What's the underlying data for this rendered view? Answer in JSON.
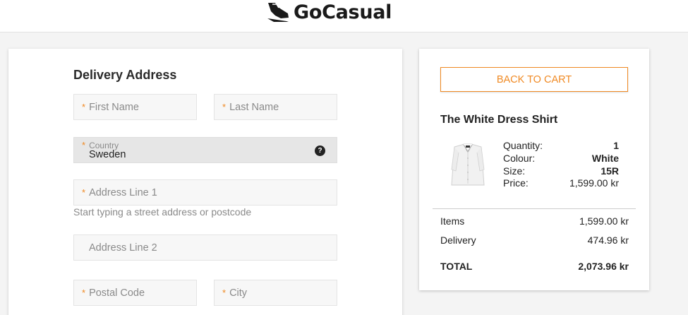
{
  "brand": {
    "name": "GoCasual",
    "icon": "sneaker-icon"
  },
  "form": {
    "title": "Delivery Address",
    "first_name_placeholder": "First Name",
    "last_name_placeholder": "Last Name",
    "country_label": "Country",
    "country_value": "Sweden",
    "help_glyph": "?",
    "address1_placeholder": "Address Line 1",
    "address1_hint": "Start typing a street address or postcode",
    "address2_placeholder": "Address Line 2",
    "postal_code_placeholder": "Postal Code",
    "city_placeholder": "City",
    "required_marker": "*"
  },
  "summary": {
    "back_label": "BACK TO CART",
    "product": {
      "name": "The White Dress Shirt",
      "image": "white-dress-shirt-image",
      "specs": [
        {
          "label": "Quantity:",
          "value": "1"
        },
        {
          "label": "Colour:",
          "value": "White"
        },
        {
          "label": "Size:",
          "value": "15R"
        },
        {
          "label": "Price:",
          "value": "1,599.00 kr"
        }
      ]
    },
    "items_label": "Items",
    "items_value": "1,599.00 kr",
    "delivery_label": "Delivery",
    "delivery_value": "474.96 kr",
    "total_label": "TOTAL",
    "total_value": "2,073.96 kr"
  },
  "colors": {
    "accent": "#f08a24",
    "field_bg": "#f7f7f7",
    "country_bg": "#e6e6e6"
  }
}
